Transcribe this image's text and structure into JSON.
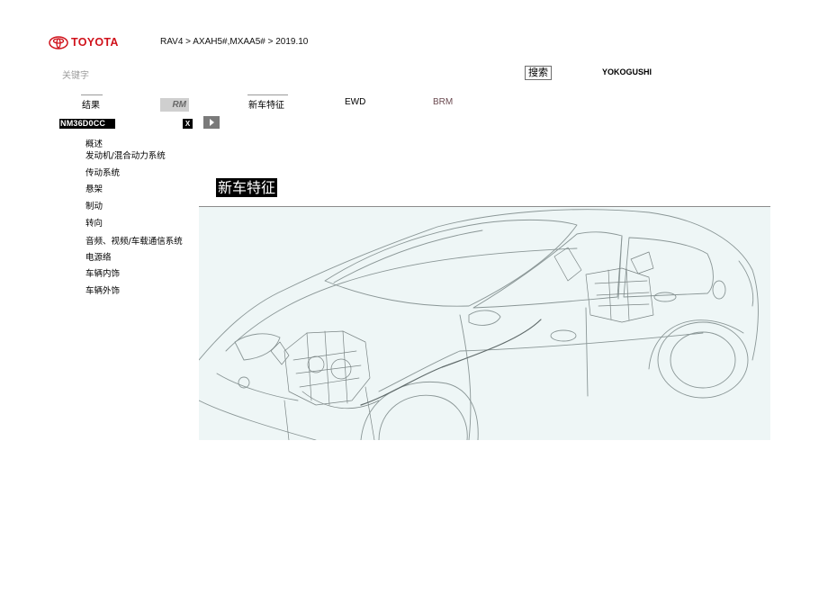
{
  "header": {
    "logo_text": "TOYOTA",
    "brand_color": "#d0121b",
    "breadcrumb": "RAV4 > AXAH5#,MXAA5# > 2019.10"
  },
  "search": {
    "placeholder": "关键字",
    "button_label": "搜索"
  },
  "user": {
    "name": "YOKOGUSHI"
  },
  "tabs": [
    {
      "label": "结果"
    },
    {
      "label": "RM",
      "active": true
    },
    {
      "label": "新车特征"
    },
    {
      "label": "EWD"
    },
    {
      "label": "BRM"
    }
  ],
  "document": {
    "id": "NM36D0CC",
    "close_label": "X"
  },
  "sidebar": {
    "items": [
      {
        "label": "概述"
      },
      {
        "label": "发动机/混合动力系统"
      },
      {
        "label": "传动系统"
      },
      {
        "label": "悬架"
      },
      {
        "label": "制动"
      },
      {
        "label": "转向"
      },
      {
        "label": "音频、视频/车载通信系统"
      },
      {
        "label": "电源络"
      },
      {
        "label": "车辆内饰"
      },
      {
        "label": "车辆外饰"
      }
    ]
  },
  "main": {
    "title": "新车特征",
    "illustration": "hybrid-vehicle-cutaway"
  }
}
